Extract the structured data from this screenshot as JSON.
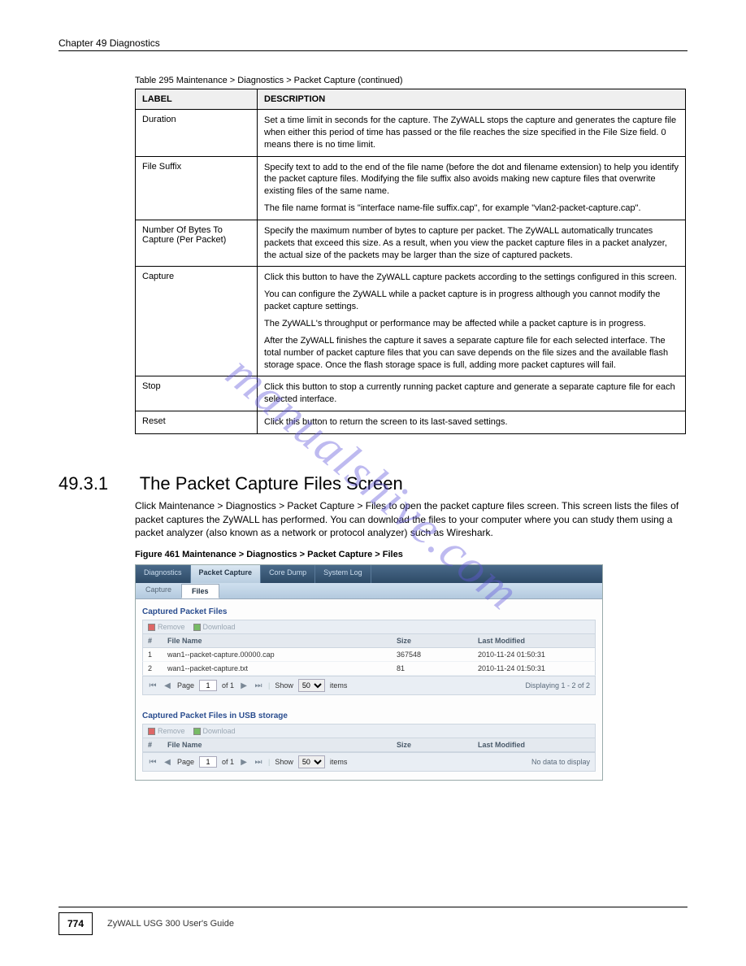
{
  "header": {
    "left": "Chapter 49 Diagnostics",
    "right": ""
  },
  "watermark": "manualshive.com",
  "tableCaption": "Table 295   Maintenance > Diagnostics > Packet Capture (continued)",
  "specTable": {
    "th1": "LABEL",
    "th2": "DESCRIPTION",
    "rows": [
      {
        "label": "Duration",
        "paras": [
          "Set a time limit in seconds for the capture. The ZyWALL stops the capture and generates the capture file when either this period of time has passed or the file reaches the size specified in the File Size field. 0 means there is no time limit."
        ]
      },
      {
        "label": "File Suffix",
        "paras": [
          "Specify text to add to the end of the file name (before the dot and filename extension) to help you identify the packet capture files. Modifying the file suffix also avoids making new capture files that overwrite existing files of the same name.",
          "The file name format is \"interface name-file suffix.cap\", for example \"vlan2-packet-capture.cap\"."
        ]
      },
      {
        "label": "Number Of Bytes To Capture (Per Packet)",
        "paras": [
          "Specify the maximum number of bytes to capture per packet. The ZyWALL automatically truncates packets that exceed this size. As a result, when you view the packet capture files in a packet analyzer, the actual size of the packets may be larger than the size of captured packets."
        ]
      },
      {
        "label": "Capture",
        "paras": [
          "Click this button to have the ZyWALL capture packets according to the settings configured in this screen.",
          "You can configure the ZyWALL while a packet capture is in progress although you cannot modify the packet capture settings.",
          "The ZyWALL's throughput or performance may be affected while a packet capture is in progress.",
          "After the ZyWALL finishes the capture it saves a separate capture file for each selected interface. The total number of packet capture files that you can save depends on the file sizes and the available flash storage space. Once the flash storage space is full, adding more packet captures will fail."
        ]
      },
      {
        "label": "Stop",
        "paras": [
          "Click this button to stop a currently running packet capture and generate a separate capture file for each selected interface."
        ]
      },
      {
        "label": "Reset",
        "paras": [
          "Click this button to return the screen to its last-saved settings."
        ]
      }
    ]
  },
  "section": {
    "num": "49.3.1",
    "title": "The Packet Capture Files Screen",
    "p1": "Click Maintenance > Diagnostics > Packet Capture > Files to open the packet capture files screen. This screen lists the files of packet captures the ZyWALL has performed. You can download the files to your computer where you can study them using a packet analyzer (also known as a network or protocol analyzer) such as Wireshark."
  },
  "figCaption": "Figure 461   Maintenance > Diagnostics > Packet Capture > Files",
  "screenshot": {
    "tabs": [
      "Diagnostics",
      "Packet Capture",
      "Core Dump",
      "System Log"
    ],
    "activeTab": 1,
    "subtabs": [
      "Capture",
      "Files"
    ],
    "activeSubtab": 1,
    "panel1": {
      "title": "Captured Packet Files",
      "btnRemove": "Remove",
      "btnDownload": "Download",
      "cols": {
        "idx": "#",
        "fn": "File Name",
        "sz": "Size",
        "lm": "Last Modified"
      },
      "rows": [
        {
          "idx": "1",
          "fn": "wan1--packet-capture.00000.cap",
          "sz": "367548",
          "lm": "2010-11-24 01:50:31"
        },
        {
          "idx": "2",
          "fn": "wan1--packet-capture.txt",
          "sz": "81",
          "lm": "2010-11-24 01:50:31"
        }
      ],
      "pager": {
        "page": "1",
        "of": "of 1",
        "showLabel": "Show",
        "show": "50",
        "items": "items",
        "status": "Displaying 1 - 2 of 2",
        "pageLabel": "Page"
      }
    },
    "panel2": {
      "title": "Captured Packet Files in USB storage",
      "btnRemove": "Remove",
      "btnDownload": "Download",
      "cols": {
        "idx": "#",
        "fn": "File Name",
        "sz": "Size",
        "lm": "Last Modified"
      },
      "pager": {
        "page": "1",
        "of": "of 1",
        "showLabel": "Show",
        "show": "50",
        "items": "items",
        "status": "No data to display",
        "pageLabel": "Page"
      }
    }
  },
  "footer": {
    "page": "774",
    "title": "ZyWALL USG 300 User's Guide"
  }
}
